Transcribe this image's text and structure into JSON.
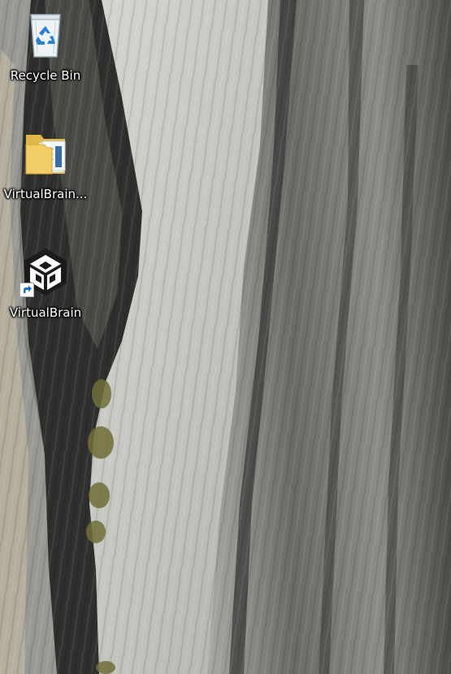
{
  "desktop": {
    "wallpaper": {
      "icon": "granite-cliff-wallpaper",
      "colors": {
        "rock_light": "#cfd0cb",
        "rock_mid": "#9c9c97",
        "rock_dark": "#3d3d3b",
        "moss": "#7a7a3a"
      }
    },
    "icons": [
      {
        "label": "Recycle Bin",
        "icon": "recycle-bin-icon"
      },
      {
        "label": "VirtualBrain...",
        "icon": "folder-icon"
      },
      {
        "label": "VirtualBrain",
        "icon": "unity-app-icon",
        "shortcut": true
      }
    ]
  }
}
